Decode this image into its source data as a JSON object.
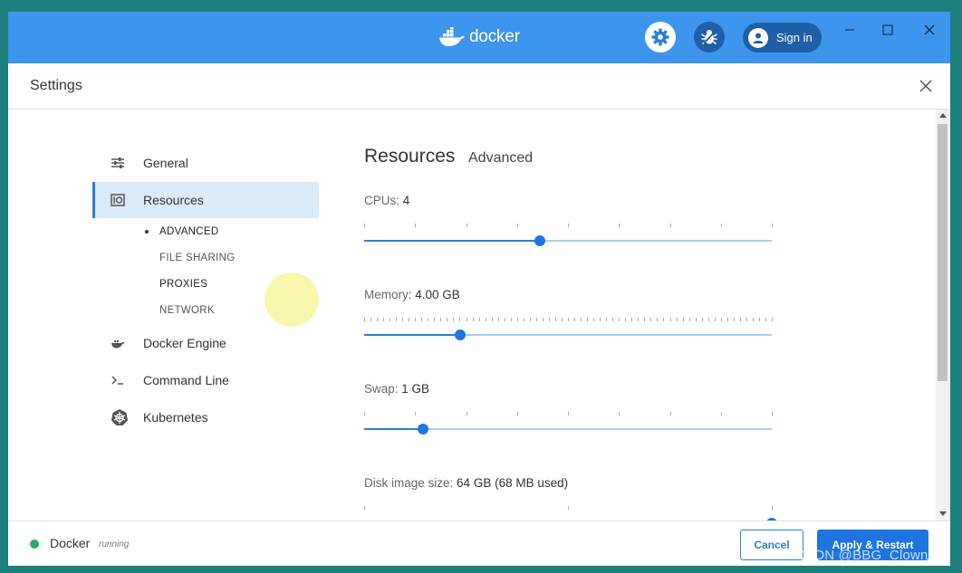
{
  "app": {
    "logo_text": "docker",
    "signin_label": "Sign in"
  },
  "settings": {
    "title": "Settings"
  },
  "sidebar": {
    "items": [
      {
        "label": "General",
        "icon": "sliders-icon"
      },
      {
        "label": "Resources",
        "icon": "resources-icon",
        "active": true
      },
      {
        "label": "Docker Engine",
        "icon": "whale-icon"
      },
      {
        "label": "Command Line",
        "icon": "terminal-icon"
      },
      {
        "label": "Kubernetes",
        "icon": "helm-icon"
      }
    ],
    "subitems": [
      "ADVANCED",
      "FILE SHARING",
      "PROXIES",
      "NETWORK"
    ]
  },
  "main": {
    "tab_title": "Resources",
    "tab_active": "Advanced",
    "cpus": {
      "label": "CPUs:",
      "value": "4",
      "fraction": 0.43
    },
    "memory": {
      "label": "Memory:",
      "value": "4.00 GB",
      "fraction": 0.235
    },
    "swap": {
      "label": "Swap:",
      "value": "1 GB",
      "fraction": 0.145
    },
    "disk": {
      "label": "Disk image size:",
      "value": "64 GB (68 MB used)",
      "fraction": 1.0
    }
  },
  "footer": {
    "status_name": "Docker",
    "status_state": "running",
    "cancel_label": "Cancel",
    "apply_label": "Apply & Restart"
  },
  "watermark": "CSDN @BBG_Clown",
  "colors": {
    "titlebar": "#3d95ee",
    "accent": "#1e74e0",
    "active_nav": "#dcebf9",
    "running": "#27ae60"
  }
}
